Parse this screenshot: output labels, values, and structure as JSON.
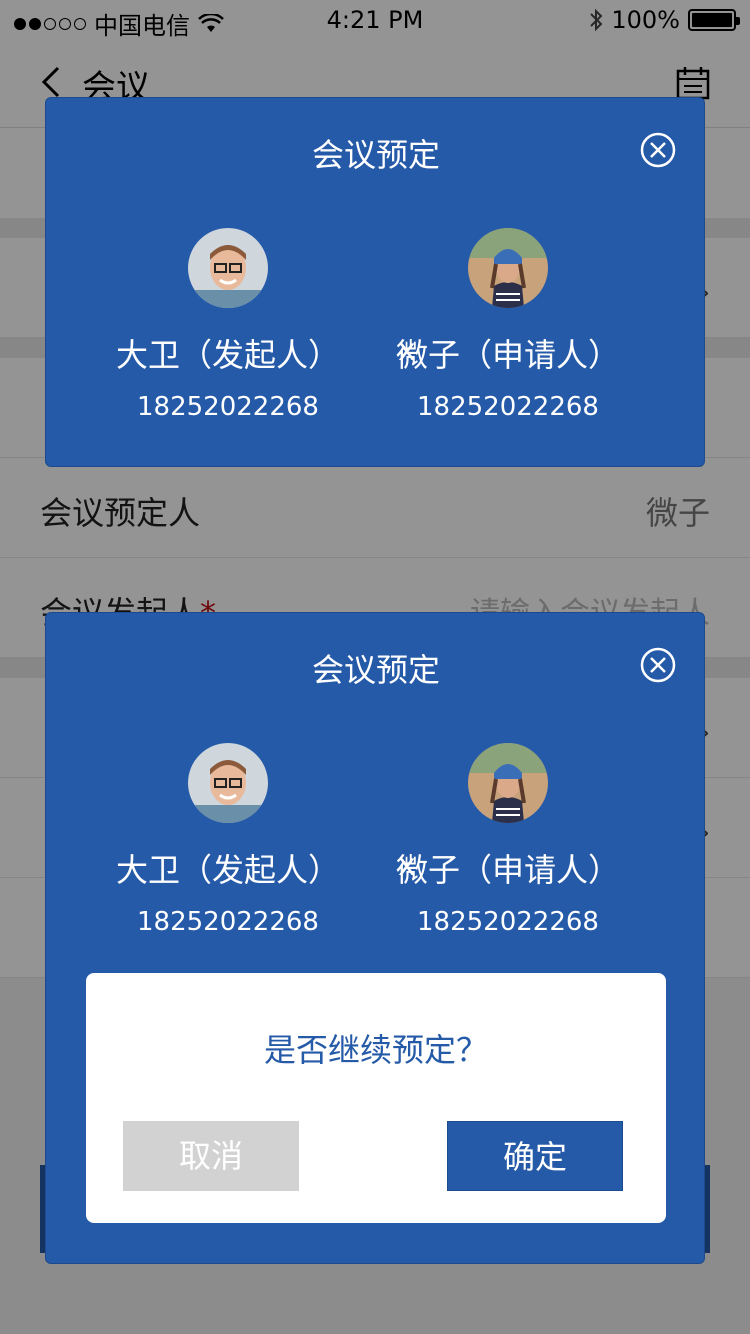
{
  "status_bar": {
    "carrier": "中国电信",
    "time": "4:21 PM",
    "battery": "100%"
  },
  "nav": {
    "title": "会议"
  },
  "form": {
    "booker_label": "会议预定人",
    "booker_value": "微子",
    "initiator_label": "会议发起人",
    "initiator_required": "*",
    "initiator_placeholder": "请输入会议发起人"
  },
  "modal": {
    "title": "会议预定",
    "times": "x",
    "initiator": {
      "name": "大卫（发起人）",
      "phone": "18252022268"
    },
    "applicant": {
      "name": "微子（申请人）",
      "phone": "18252022268"
    }
  },
  "confirm": {
    "question": "是否继续预定？",
    "cancel_label": "取消",
    "ok_label": "确定"
  },
  "colors": {
    "primary": "#255aa8",
    "cancel_gray": "#d2d2d2",
    "required_red": "#c0141b"
  }
}
